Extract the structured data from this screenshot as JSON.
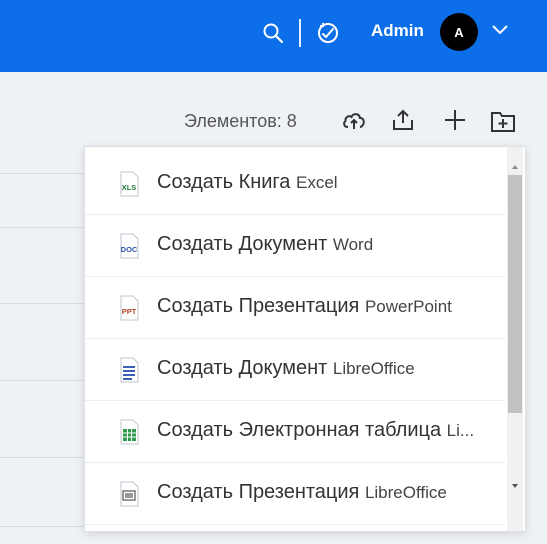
{
  "topbar": {
    "user_name": "Admin",
    "avatar_initial": "A",
    "accent": "#0c6fe9"
  },
  "toolbar": {
    "count_label": "Элементов: 8",
    "icons": [
      "cloud-upload-icon",
      "share-icon",
      "plus-icon",
      "new-folder-icon"
    ]
  },
  "menu": {
    "items": [
      {
        "main": "Создать Книга",
        "suffix": "Excel",
        "icon": "xls-file-icon",
        "badge": "XLS"
      },
      {
        "main": "Создать Документ",
        "suffix": "Word",
        "icon": "doc-file-icon",
        "badge": "DOC"
      },
      {
        "main": "Создать Презентация",
        "suffix": "PowerPoint",
        "icon": "ppt-file-icon",
        "badge": "PPT"
      },
      {
        "main": "Создать Документ",
        "suffix": "LibreOffice",
        "icon": "libre-writer-icon"
      },
      {
        "main": "Создать Электронная таблица",
        "suffix": "Li...",
        "icon": "libre-calc-icon"
      },
      {
        "main": "Создать Презентация",
        "suffix": "LibreOffice",
        "icon": "libre-impress-icon"
      }
    ]
  }
}
